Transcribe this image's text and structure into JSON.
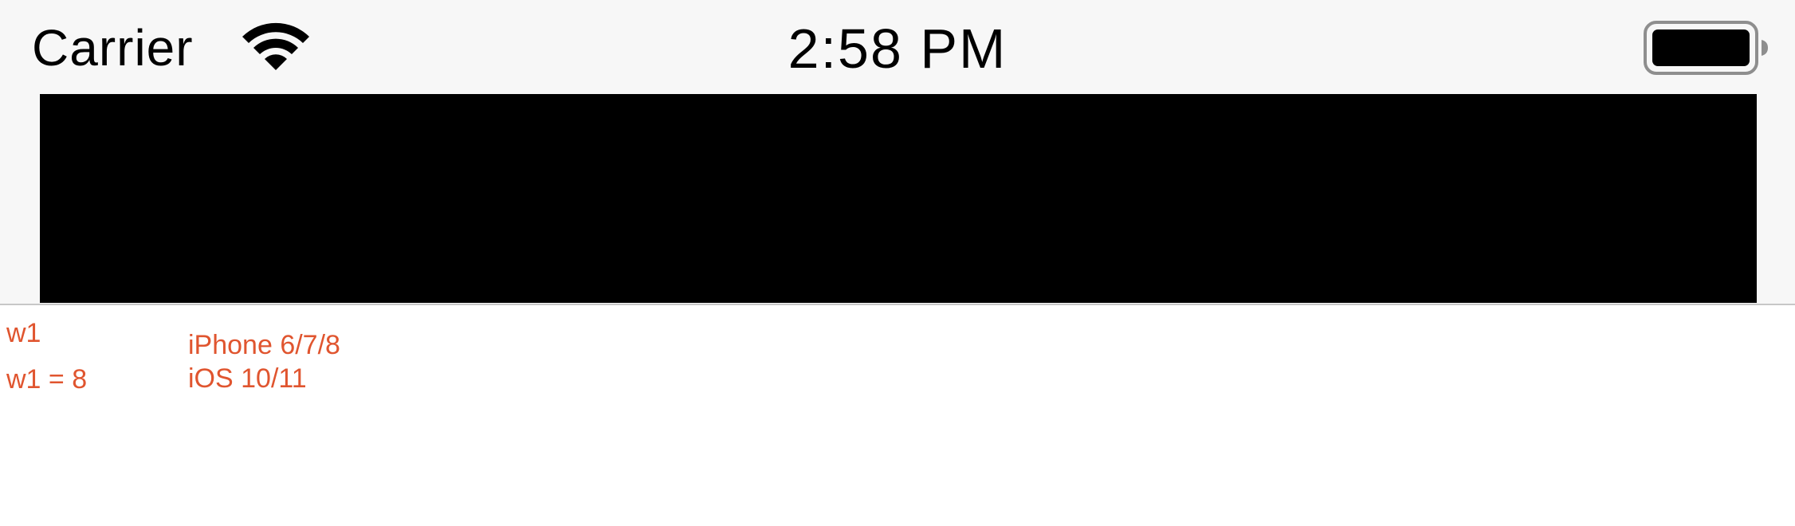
{
  "status_bar": {
    "carrier": "Carrier",
    "time": "2:58 PM",
    "wifi_icon": "wifi-icon",
    "battery_icon": "battery-full-icon"
  },
  "debug": {
    "w1_label": "w1",
    "w1_value": "w1 = 8",
    "device": "iPhone 6/7/8",
    "os": "iOS 10/11"
  },
  "colors": {
    "debug_text": "#e0552f",
    "status_bar_bg": "#f7f7f7",
    "bar": "#000000"
  }
}
